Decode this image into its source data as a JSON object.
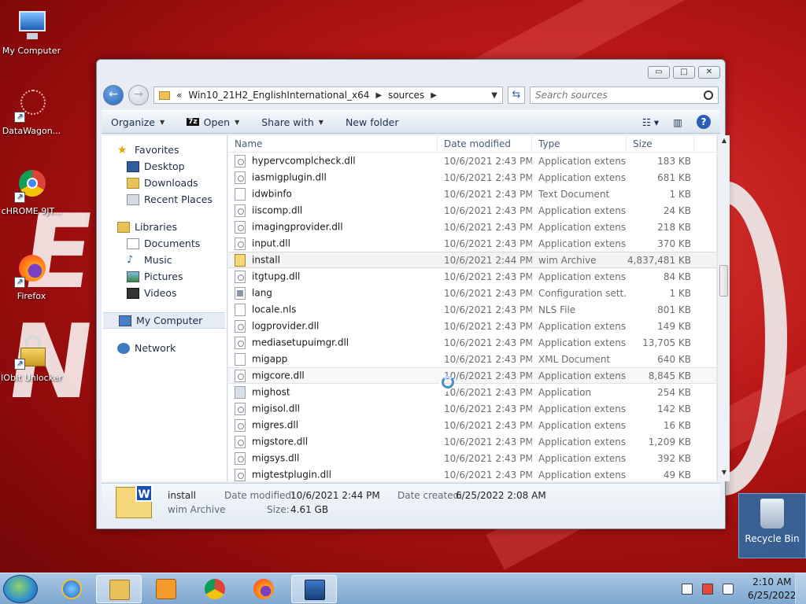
{
  "desktop": {
    "icons": [
      {
        "label": "My Computer"
      },
      {
        "label": "DataWagon..."
      },
      {
        "label": "cHROME 9JT..."
      },
      {
        "label": "Firefox"
      },
      {
        "label": "IObit Unlocker"
      }
    ],
    "recycle_bin": {
      "label": "Recycle Bin"
    }
  },
  "window": {
    "address": {
      "overflow": "«",
      "segments": [
        "Win10_21H2_EnglishInternational_x64",
        "sources"
      ]
    },
    "search": {
      "placeholder": "Search sources"
    },
    "toolbar": {
      "organize": "Organize",
      "open": "Open",
      "open_badge": "7z",
      "share_with": "Share with",
      "new_folder": "New folder"
    },
    "nav": {
      "favorites": {
        "label": "Favorites",
        "items": [
          "Desktop",
          "Downloads",
          "Recent Places"
        ]
      },
      "libraries": {
        "label": "Libraries",
        "items": [
          "Documents",
          "Music",
          "Pictures",
          "Videos"
        ]
      },
      "computer": "My Computer",
      "network": "Network"
    },
    "columns": {
      "name": "Name",
      "date": "Date modified",
      "type": "Type",
      "size": "Size"
    },
    "files": [
      {
        "name": "hypervcomplcheck.dll",
        "date": "10/6/2021 2:43 PM",
        "type": "Application extens...",
        "size": "183 KB",
        "icon": "dll"
      },
      {
        "name": "iasmigplugin.dll",
        "date": "10/6/2021 2:43 PM",
        "type": "Application extens...",
        "size": "681 KB",
        "icon": "dll"
      },
      {
        "name": "idwbinfo",
        "date": "10/6/2021 2:43 PM",
        "type": "Text Document",
        "size": "1 KB",
        "icon": "txt"
      },
      {
        "name": "iiscomp.dll",
        "date": "10/6/2021 2:43 PM",
        "type": "Application extens...",
        "size": "24 KB",
        "icon": "dll"
      },
      {
        "name": "imagingprovider.dll",
        "date": "10/6/2021 2:43 PM",
        "type": "Application extens...",
        "size": "218 KB",
        "icon": "dll"
      },
      {
        "name": "input.dll",
        "date": "10/6/2021 2:43 PM",
        "type": "Application extens...",
        "size": "370 KB",
        "icon": "dll"
      },
      {
        "name": "install",
        "date": "10/6/2021 2:44 PM",
        "type": "wim Archive",
        "size": "4,837,481 KB",
        "icon": "wim"
      },
      {
        "name": "itgtupg.dll",
        "date": "10/6/2021 2:43 PM",
        "type": "Application extens...",
        "size": "84 KB",
        "icon": "dll"
      },
      {
        "name": "lang",
        "date": "10/6/2021 2:43 PM",
        "type": "Configuration sett...",
        "size": "1 KB",
        "icon": "cfg"
      },
      {
        "name": "locale.nls",
        "date": "10/6/2021 2:43 PM",
        "type": "NLS File",
        "size": "801 KB",
        "icon": "txt"
      },
      {
        "name": "logprovider.dll",
        "date": "10/6/2021 2:43 PM",
        "type": "Application extens...",
        "size": "149 KB",
        "icon": "dll"
      },
      {
        "name": "mediasetupuimgr.dll",
        "date": "10/6/2021 2:43 PM",
        "type": "Application extens...",
        "size": "13,705 KB",
        "icon": "dll"
      },
      {
        "name": "migapp",
        "date": "10/6/2021 2:43 PM",
        "type": "XML Document",
        "size": "640 KB",
        "icon": "txt"
      },
      {
        "name": "migcore.dll",
        "date": "10/6/2021 2:43 PM",
        "type": "Application extens...",
        "size": "8,845 KB",
        "icon": "dll"
      },
      {
        "name": "mighost",
        "date": "10/6/2021 2:43 PM",
        "type": "Application",
        "size": "254 KB",
        "icon": "exe"
      },
      {
        "name": "migisol.dll",
        "date": "10/6/2021 2:43 PM",
        "type": "Application extens...",
        "size": "142 KB",
        "icon": "dll"
      },
      {
        "name": "migres.dll",
        "date": "10/6/2021 2:43 PM",
        "type": "Application extens...",
        "size": "16 KB",
        "icon": "dll"
      },
      {
        "name": "migstore.dll",
        "date": "10/6/2021 2:43 PM",
        "type": "Application extens...",
        "size": "1,209 KB",
        "icon": "dll"
      },
      {
        "name": "migsys.dll",
        "date": "10/6/2021 2:43 PM",
        "type": "Application extens...",
        "size": "392 KB",
        "icon": "dll"
      },
      {
        "name": "migtestplugin.dll",
        "date": "10/6/2021 2:43 PM",
        "type": "Application extens...",
        "size": "49 KB",
        "icon": "dll"
      }
    ],
    "details": {
      "name": "install",
      "type": "wim Archive",
      "modified_label": "Date modified:",
      "modified_value": "10/6/2021 2:44 PM",
      "created_label": "Date created:",
      "created_value": "6/25/2022 2:08 AM",
      "size_label": "Size:",
      "size_value": "4.61 GB"
    }
  },
  "taskbar": {
    "clock_time": "2:10 AM",
    "clock_date": "6/25/2022"
  },
  "colors": {
    "accent": "#2b62b4",
    "desktop": "#b81616"
  }
}
